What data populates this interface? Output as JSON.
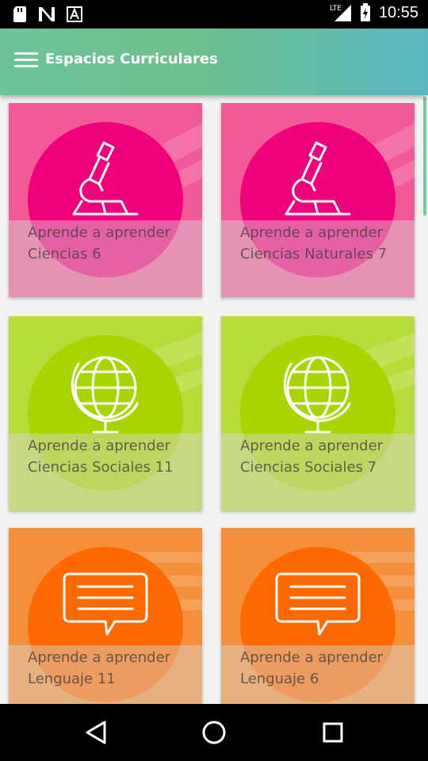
{
  "status_bar": {
    "time": "10:55",
    "network": "LTE",
    "icons": [
      "sd-card-icon",
      "n-app-icon",
      "a-app-icon",
      "lte-signal-icon",
      "battery-charging-icon"
    ]
  },
  "app_bar": {
    "title": "Espacios Curriculares",
    "menu_icon": "hamburger-menu-icon"
  },
  "courses": [
    {
      "title": "Aprende a aprender Ciencias 6",
      "icon": "microscope-icon",
      "color": "#f0007a",
      "bg": "#f25a97"
    },
    {
      "title": "Aprende a aprender Ciencias Naturales 7",
      "icon": "microscope-icon",
      "color": "#f0007a",
      "bg": "#f25a97"
    },
    {
      "title": "Aprende a aprender Ciencias Sociales 11",
      "icon": "globe-icon",
      "color": "#a8d400",
      "bg": "#b6dc3a"
    },
    {
      "title": "Aprende a aprender Ciencias Sociales 7",
      "icon": "globe-icon",
      "color": "#a8d400",
      "bg": "#b6dc3a"
    },
    {
      "title": "Aprende a aprender Lenguaje 11",
      "icon": "speech-bubble-icon",
      "color": "#ff6a00",
      "bg": "#f5903a"
    },
    {
      "title": "Aprende a aprender Lenguaje 6",
      "icon": "speech-bubble-icon",
      "color": "#ff6a00",
      "bg": "#f5903a"
    }
  ],
  "nav_bar": {
    "back_icon": "back-triangle-icon",
    "home_icon": "home-circle-icon",
    "recents_icon": "recents-square-icon"
  }
}
